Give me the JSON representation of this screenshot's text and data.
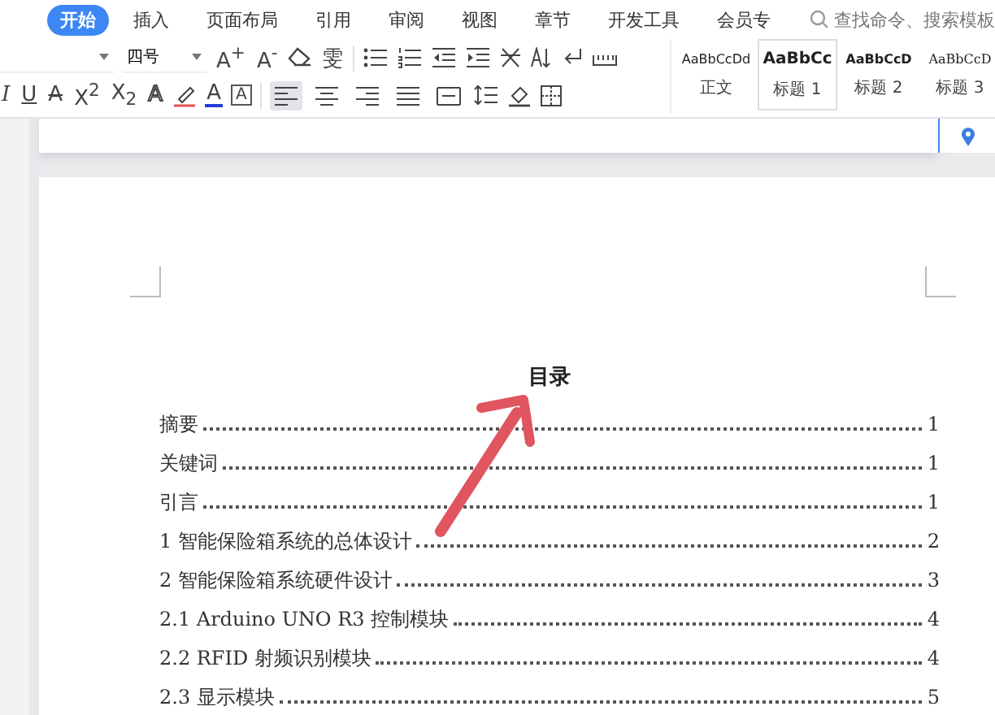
{
  "menu_bar": {
    "tabs": [
      {
        "label": "开始",
        "selected": true
      },
      {
        "label": "插入",
        "selected": false
      },
      {
        "label": "页面布局",
        "selected": false
      },
      {
        "label": "引用",
        "selected": false
      },
      {
        "label": "审阅",
        "selected": false
      },
      {
        "label": "视图",
        "selected": false
      },
      {
        "label": "章节",
        "selected": false
      },
      {
        "label": "开发工具",
        "selected": false
      },
      {
        "label": "会员专",
        "selected": false
      }
    ],
    "search": {
      "placeholder": "查找命令、搜索模板"
    }
  },
  "toolbar": {
    "font_size": "四号",
    "row1_glyphs": [
      "A$^{+}$",
      "A$^{-}$"
    ],
    "pinyin_glyph": "雯",
    "row2_glyphs": [
      {
        "kind": "italic",
        "glyph": "I"
      },
      {
        "kind": "underline",
        "glyph": "U"
      },
      {
        "kind": "strike",
        "glyph": "A"
      },
      {
        "kind": "plain",
        "glyph": "X$^{2}$"
      },
      {
        "kind": "plain",
        "glyph": "X$_{2}$"
      },
      {
        "kind": "outline",
        "glyph": "A"
      }
    ],
    "font_color_glyph": "A",
    "boxed_glyph": "A",
    "alignment": [
      {
        "kind": "left",
        "selected": true
      },
      {
        "kind": "center",
        "selected": false
      },
      {
        "kind": "right",
        "selected": false
      },
      {
        "kind": "justify",
        "selected": false
      },
      {
        "kind": "distributed",
        "selected": false
      }
    ]
  },
  "styles": [
    {
      "preview": "AaBbCcDd",
      "label": "正文",
      "kind": "normal",
      "selected": false
    },
    {
      "preview": "AaBbCc",
      "label": "标题 1",
      "kind": "h1",
      "selected": true
    },
    {
      "preview": "AaBbCcD",
      "label": "标题 2",
      "kind": "h2",
      "selected": false
    },
    {
      "preview": "AaBbCcD",
      "label": "标题 3",
      "kind": "h3",
      "selected": false
    }
  ],
  "document": {
    "toc_title": "目录",
    "toc": [
      {
        "title": "摘要",
        "page": "1"
      },
      {
        "title": "关键词",
        "page": "1"
      },
      {
        "title": "引言",
        "page": "1"
      },
      {
        "title": "1 智能保险箱系统的总体设计",
        "page": "2"
      },
      {
        "title": "2 智能保险箱系统硬件设计",
        "page": "3"
      },
      {
        "title": "2.1  Arduino UNO R3 控制模块",
        "page": "4"
      },
      {
        "title": "2.2  RFID 射频识别模块",
        "page": "4"
      },
      {
        "title": "2.3  显示模块",
        "page": "5"
      }
    ]
  }
}
